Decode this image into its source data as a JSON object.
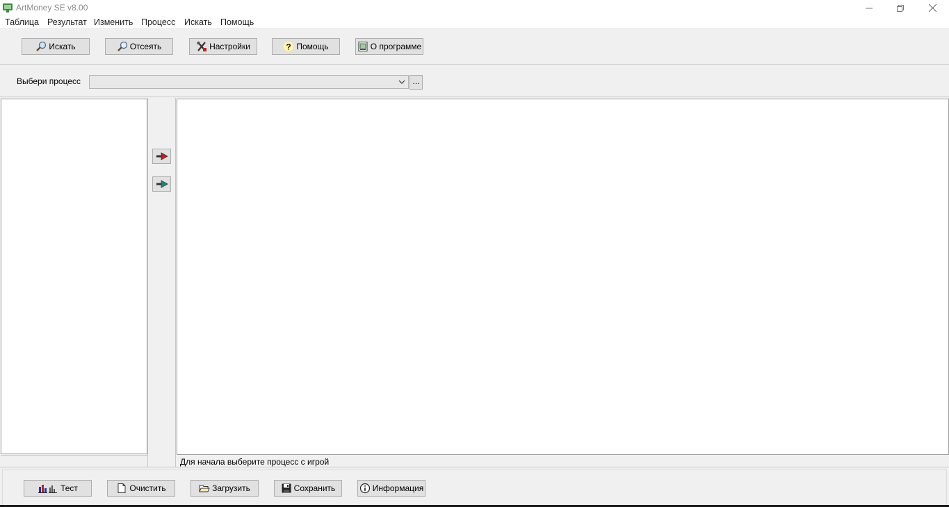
{
  "window": {
    "title": "ArtMoney SE v8.00"
  },
  "menu": [
    "Таблица",
    "Результат",
    "Изменить",
    "Процесс",
    "Искать",
    "Помощь"
  ],
  "toolbar": {
    "search": "Искать",
    "filter": "Отсеять",
    "settings": "Настройки",
    "help": "Помощь",
    "about": "О программе"
  },
  "process": {
    "label": "Выбери процесс",
    "selected": "",
    "browse": "..."
  },
  "status": {
    "text": "Для начала выберите процесс с игрой"
  },
  "bottom": {
    "test": "Тест",
    "clear": "Очистить",
    "load": "Загрузить",
    "save": "Сохранить",
    "info": "Информация"
  },
  "colors": {
    "arrow_right": "#d01818",
    "arrow_left": "#1b8a7a"
  }
}
